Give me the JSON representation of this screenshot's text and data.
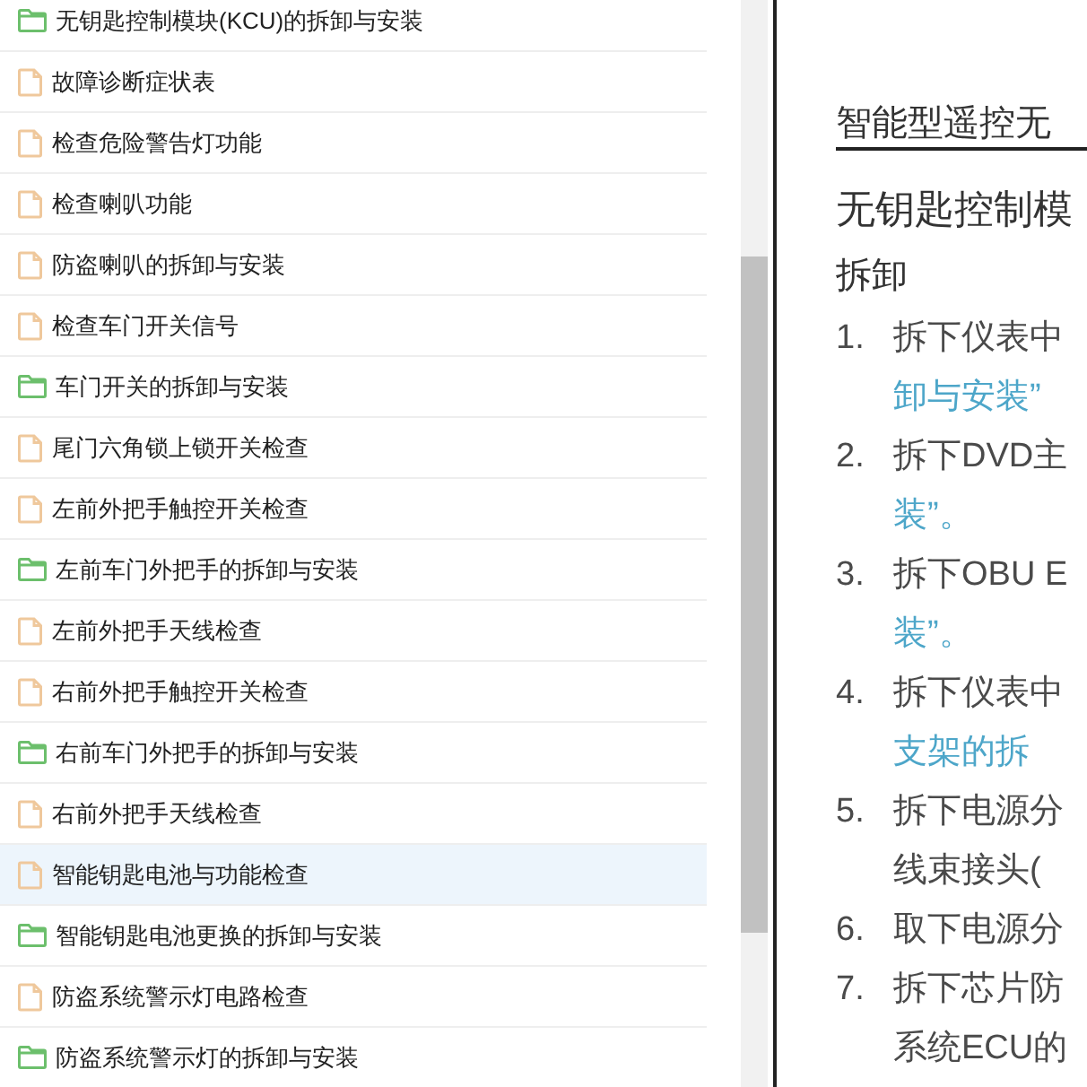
{
  "sidebar": {
    "items": [
      {
        "kind": "folder",
        "label": "无钥匙控制模块(KCU)的拆卸与安装",
        "selected": false
      },
      {
        "kind": "file",
        "label": "故障诊断症状表",
        "selected": false
      },
      {
        "kind": "file",
        "label": "检查危险警告灯功能",
        "selected": false
      },
      {
        "kind": "file",
        "label": "检查喇叭功能",
        "selected": false
      },
      {
        "kind": "file",
        "label": "防盗喇叭的拆卸与安装",
        "selected": false
      },
      {
        "kind": "file",
        "label": "检查车门开关信号",
        "selected": false
      },
      {
        "kind": "folder",
        "label": "车门开关的拆卸与安装",
        "selected": false
      },
      {
        "kind": "file",
        "label": "尾门六角锁上锁开关检查",
        "selected": false
      },
      {
        "kind": "file",
        "label": "左前外把手触控开关检查",
        "selected": false
      },
      {
        "kind": "folder",
        "label": "左前车门外把手的拆卸与安装",
        "selected": false
      },
      {
        "kind": "file",
        "label": "左前外把手天线检查",
        "selected": false
      },
      {
        "kind": "file",
        "label": "右前外把手触控开关检查",
        "selected": false
      },
      {
        "kind": "folder",
        "label": "右前车门外把手的拆卸与安装",
        "selected": false
      },
      {
        "kind": "file",
        "label": "右前外把手天线检查",
        "selected": false
      },
      {
        "kind": "file",
        "label": "智能钥匙电池与功能检查",
        "selected": true
      },
      {
        "kind": "folder",
        "label": "智能钥匙电池更换的拆卸与安装",
        "selected": false
      },
      {
        "kind": "file",
        "label": "防盗系统警示灯电路检查",
        "selected": false
      },
      {
        "kind": "folder",
        "label": "防盗系统警示灯的拆卸与安装",
        "selected": false
      }
    ]
  },
  "document": {
    "title": "智能型遥控无",
    "section_heading": "无钥匙控制模",
    "subheading": "拆卸",
    "steps": [
      {
        "number": "1.",
        "lines": [
          {
            "kind": "text",
            "text": "拆下仪表中"
          },
          {
            "kind": "link",
            "text": "卸与安装”"
          }
        ]
      },
      {
        "number": "2.",
        "lines": [
          {
            "kind": "text",
            "text": "拆下DVD主"
          },
          {
            "kind": "link",
            "text": "装”。"
          }
        ]
      },
      {
        "number": "3.",
        "lines": [
          {
            "kind": "text",
            "text": "拆下OBU E"
          },
          {
            "kind": "link",
            "text": "装”。"
          }
        ]
      },
      {
        "number": "4.",
        "lines": [
          {
            "kind": "text",
            "text": "拆下仪表中"
          },
          {
            "kind": "link",
            "text": "支架的拆"
          }
        ]
      },
      {
        "number": "5.",
        "lines": [
          {
            "kind": "text",
            "text": "拆下电源分"
          },
          {
            "kind": "text",
            "text": "线束接头("
          }
        ]
      },
      {
        "number": "6.",
        "lines": [
          {
            "kind": "text",
            "text": "取下电源分"
          }
        ]
      },
      {
        "number": "7.",
        "lines": [
          {
            "kind": "text",
            "text": "拆下芯片防"
          },
          {
            "kind": "text",
            "text": "系统ECU的"
          }
        ]
      }
    ]
  }
}
